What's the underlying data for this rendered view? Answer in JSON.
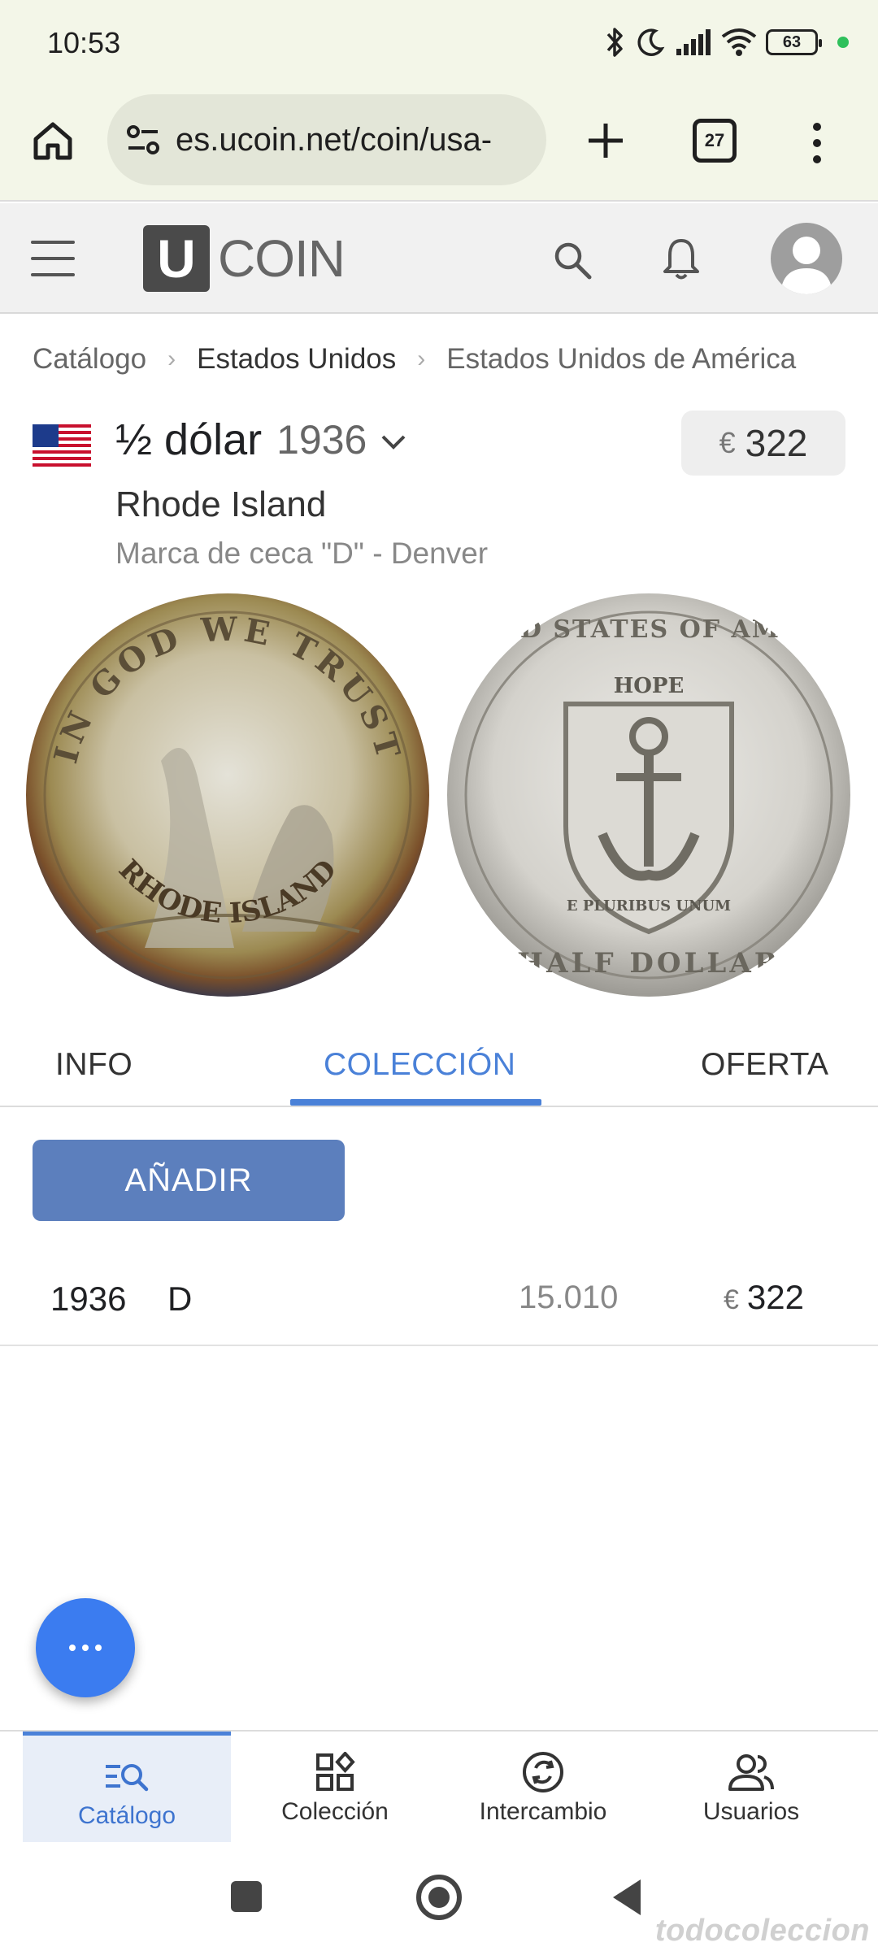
{
  "status_bar": {
    "time": "10:53",
    "battery": "63"
  },
  "browser": {
    "url": "es.ucoin.net/coin/usa-",
    "tab_count": "27"
  },
  "site": {
    "logo_letter": "U",
    "logo_text": "COIN"
  },
  "breadcrumb": {
    "items": [
      "Catálogo",
      "Estados Unidos",
      "Estados Unidos de América"
    ]
  },
  "coin": {
    "denomination": "½ dólar",
    "year": "1936",
    "price_currency": "€",
    "price_value": "322",
    "subtitle": "Rhode Island",
    "mint_mark": "Marca de ceca \"D\" - Denver",
    "obverse_legend": "IN GOD WE TRUST",
    "obverse_bottom": "RHODE ISLAND",
    "reverse_legend": "UNITED STATES OF AMERICA",
    "reverse_bottom": "HALF DOLLAR",
    "reverse_motto": "HOPE",
    "reverse_pluribus": "E PLURIBUS UNUM"
  },
  "tabs": {
    "info": "INFO",
    "coleccion": "COLECCIÓN",
    "oferta": "OFERTA",
    "active": "coleccion"
  },
  "collection": {
    "add_label": "AÑADIR",
    "rows": [
      {
        "year": "1936",
        "mint": "D",
        "mintage": "15.010",
        "currency": "€",
        "price": "322"
      }
    ]
  },
  "bottom_nav": {
    "items": [
      {
        "label": "Catálogo",
        "icon": "catalog-search-icon",
        "active": true
      },
      {
        "label": "Colección",
        "icon": "grid-shapes-icon",
        "active": false
      },
      {
        "label": "Intercambio",
        "icon": "exchange-cycle-icon",
        "active": false
      },
      {
        "label": "Usuarios",
        "icon": "users-icon",
        "active": false
      }
    ]
  },
  "watermark": "todocoleccion",
  "colors": {
    "accent": "#4a81d8",
    "add_button": "#5c7fbd",
    "fab": "#3b7cf0",
    "browser_bar": "#f3f6e8"
  }
}
